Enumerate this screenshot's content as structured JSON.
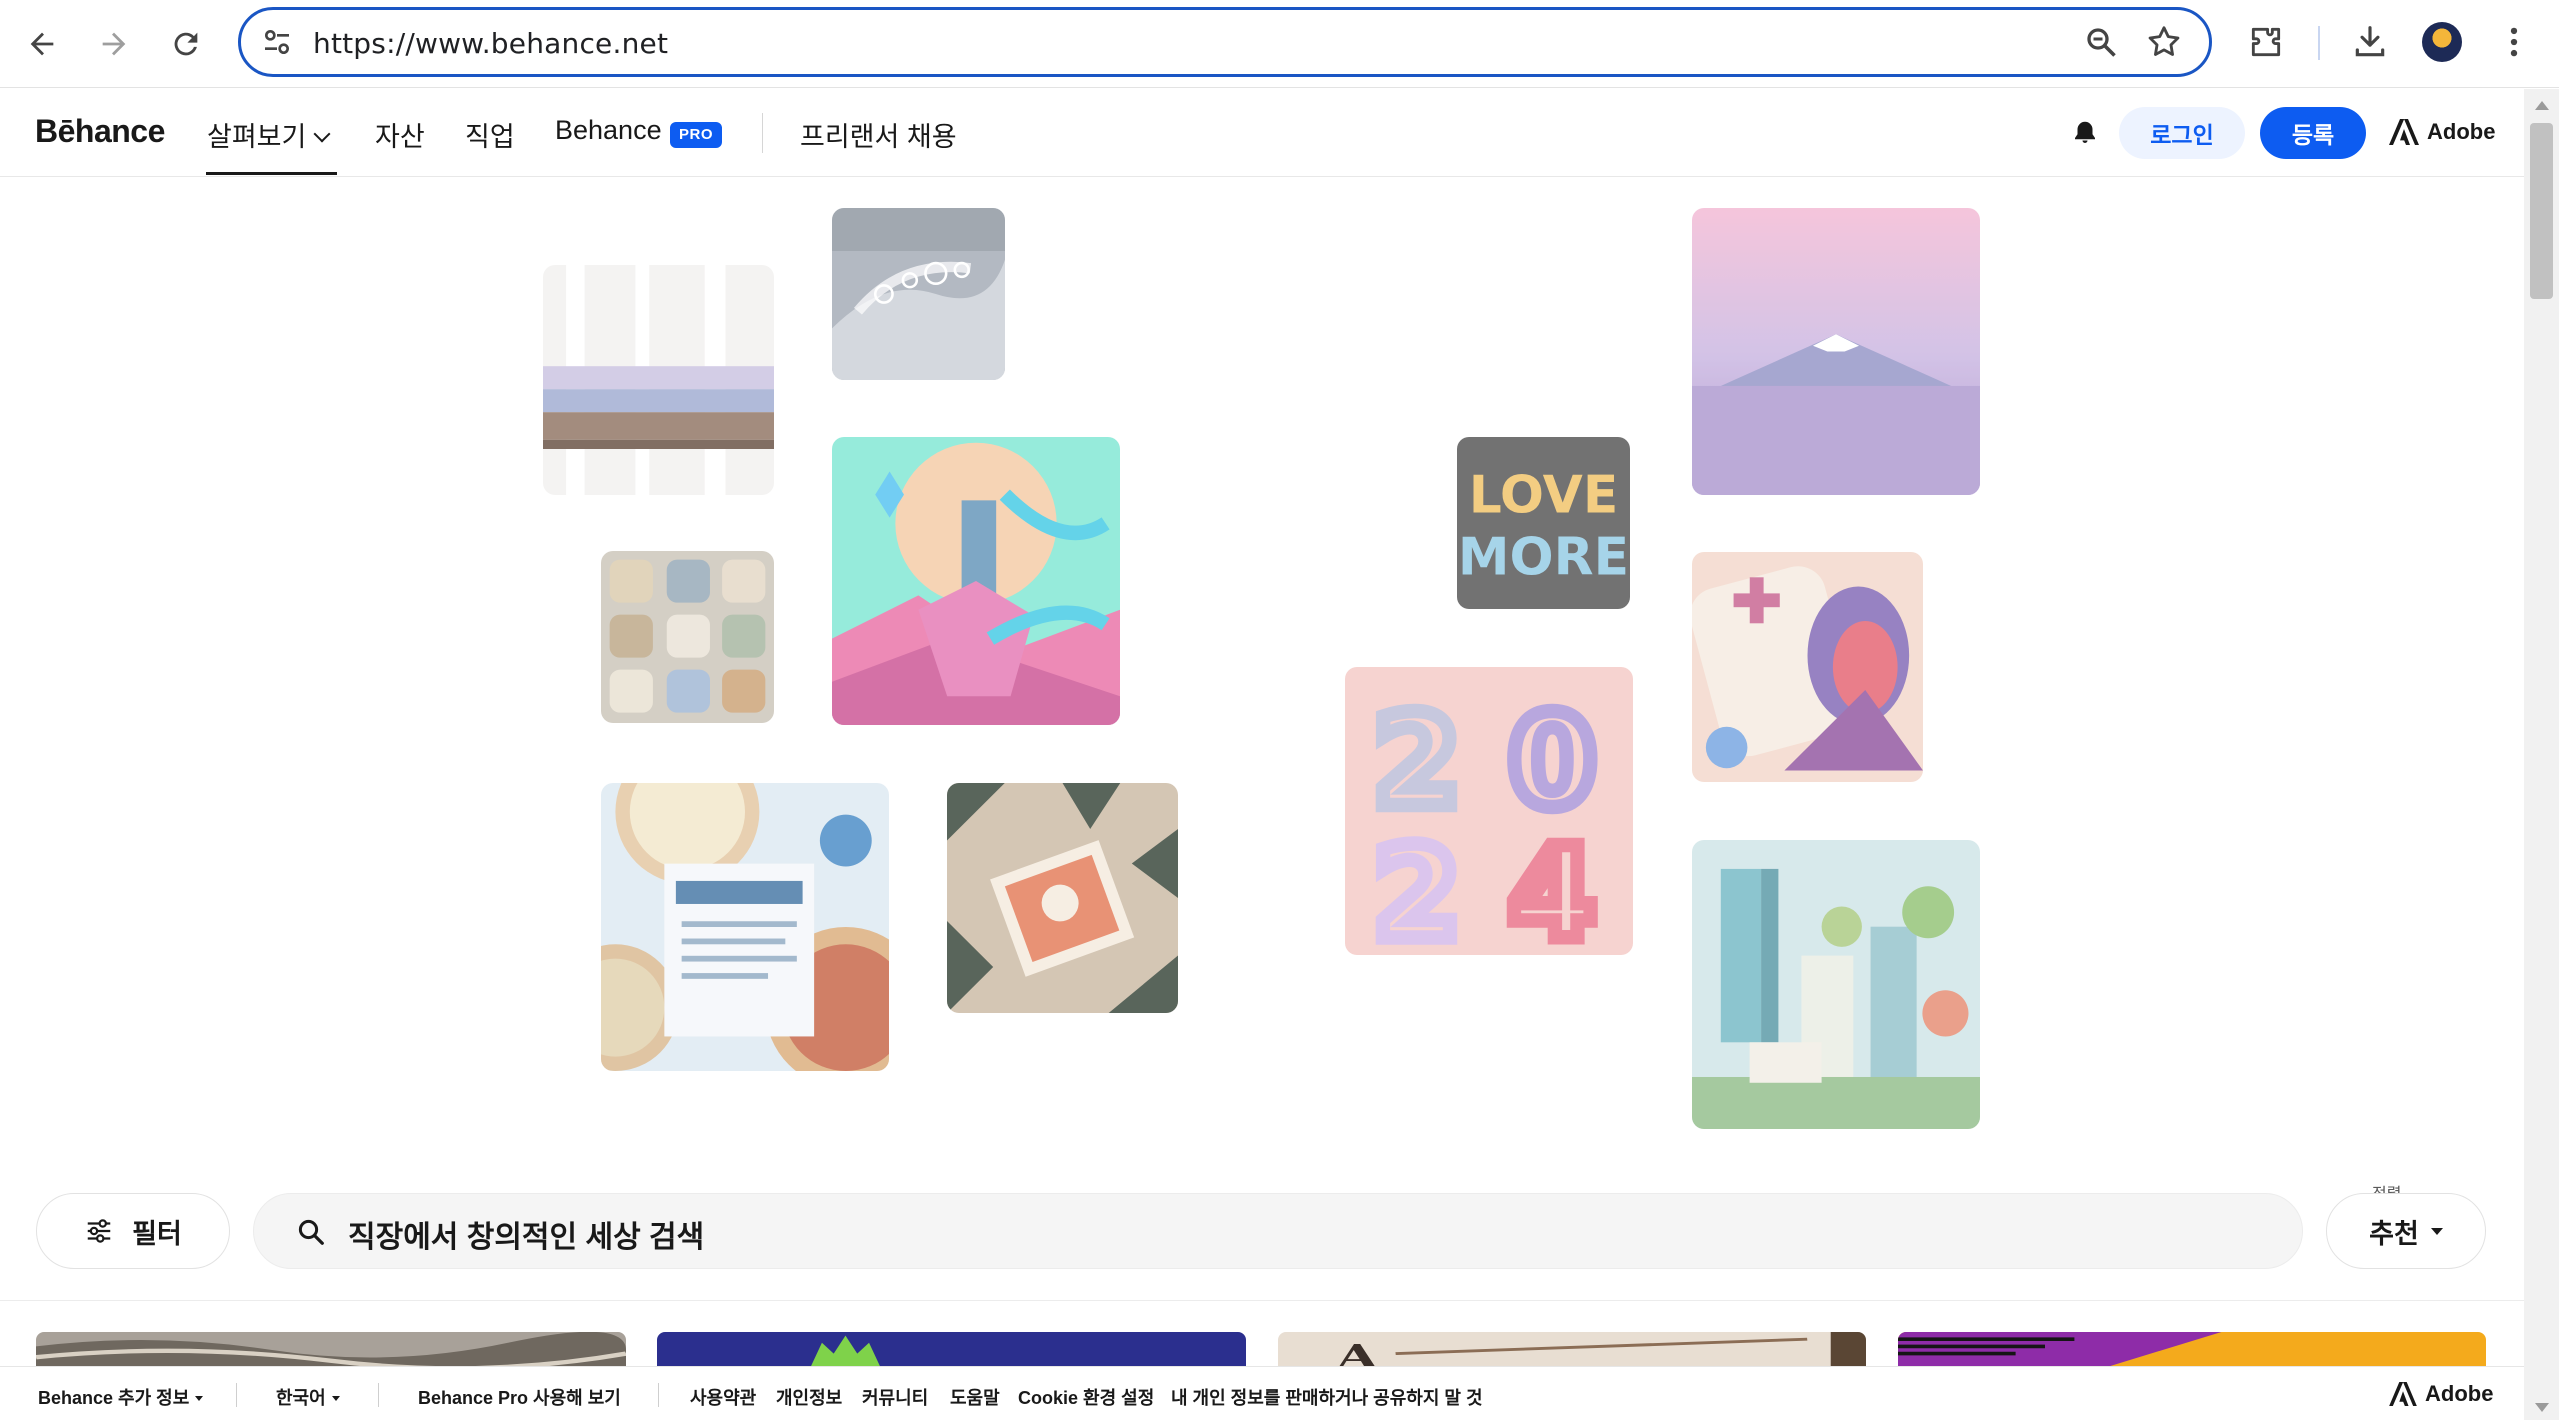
{
  "browser": {
    "url": "https://www.behance.net",
    "icons": [
      "back-icon",
      "forward-icon",
      "reload-icon",
      "site-settings-icon",
      "zoom-icon",
      "bookmark-star-icon",
      "extensions-icon",
      "download-icon",
      "profile-avatar",
      "more-menu-icon"
    ]
  },
  "header": {
    "logo": "Bēhance",
    "nav": {
      "explore": "살펴보기",
      "assets": "자산",
      "jobs": "직업",
      "behance_pro": "Behance",
      "pro_badge": "PRO",
      "hire": "프리랜서 채용"
    },
    "login": "로그인",
    "signup": "등록",
    "adobe": "Adobe",
    "colors": {
      "accent": "#0d5cf1",
      "login_bg": "#edf3ff"
    }
  },
  "hero": {
    "tiles": [
      "magazines-on-shelf",
      "liquid-bubbles",
      "neon-cowboy-illustration",
      "ceramic-mugs",
      "alberico-pizza-menu",
      "retro-print-artwork",
      "love-more-lettering",
      "mountain-lake-gradient",
      "gameboy-3d-illustration",
      "2024-typography",
      "isometric-city"
    ]
  },
  "search": {
    "filter_label": "필터",
    "placeholder": "직장에서 창의적인 세상 검색",
    "sort_caption": "정렬",
    "sort_value": "추천"
  },
  "footer": {
    "more_info": "Behance 추가 정보",
    "language": "한국어",
    "try_pro": "Behance Pro 사용해 보기",
    "terms": "사용약관",
    "privacy": "개인정보",
    "community": "커뮤니티",
    "help": "도움말",
    "cookie": "Cookie 환경 설정",
    "do_not_sell": "내 개인 정보를 판매하거나 공유하지 말 것",
    "adobe": "Adobe"
  }
}
